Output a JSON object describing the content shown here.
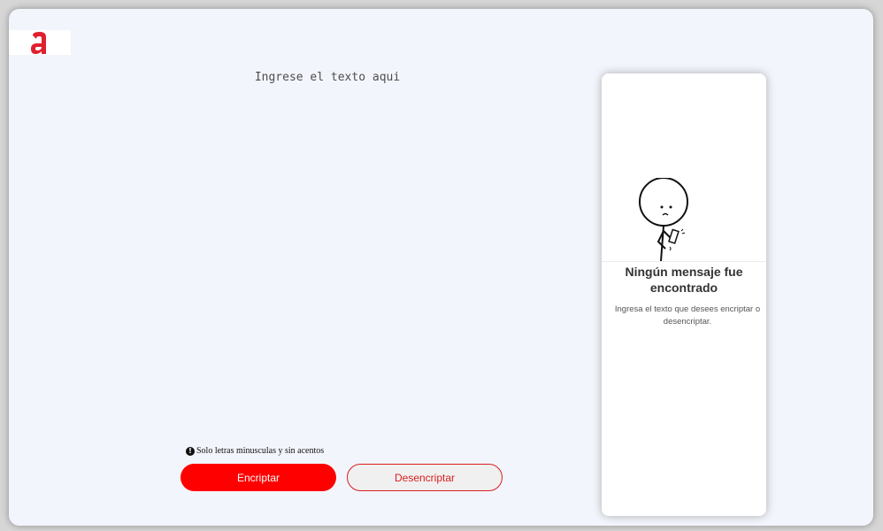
{
  "logo": {
    "letter": "a",
    "color": "#e0202e",
    "icon": "logo-a-icon"
  },
  "input": {
    "placeholder": "Ingrese el texto aqui",
    "value": ""
  },
  "hint": {
    "icon": "info-circle-icon",
    "icon_glyph": "!",
    "text": "Solo letras minusculas y sin acentos"
  },
  "buttons": {
    "encrypt_label": "Encriptar",
    "decrypt_label": "Desencriptar",
    "accent": "#ff0000"
  },
  "result": {
    "illustration": "person-with-phone-icon",
    "title": "Ningún mensaje fue encontrado",
    "text": "Ingresa el texto que desees encriptar o desencriptar."
  }
}
